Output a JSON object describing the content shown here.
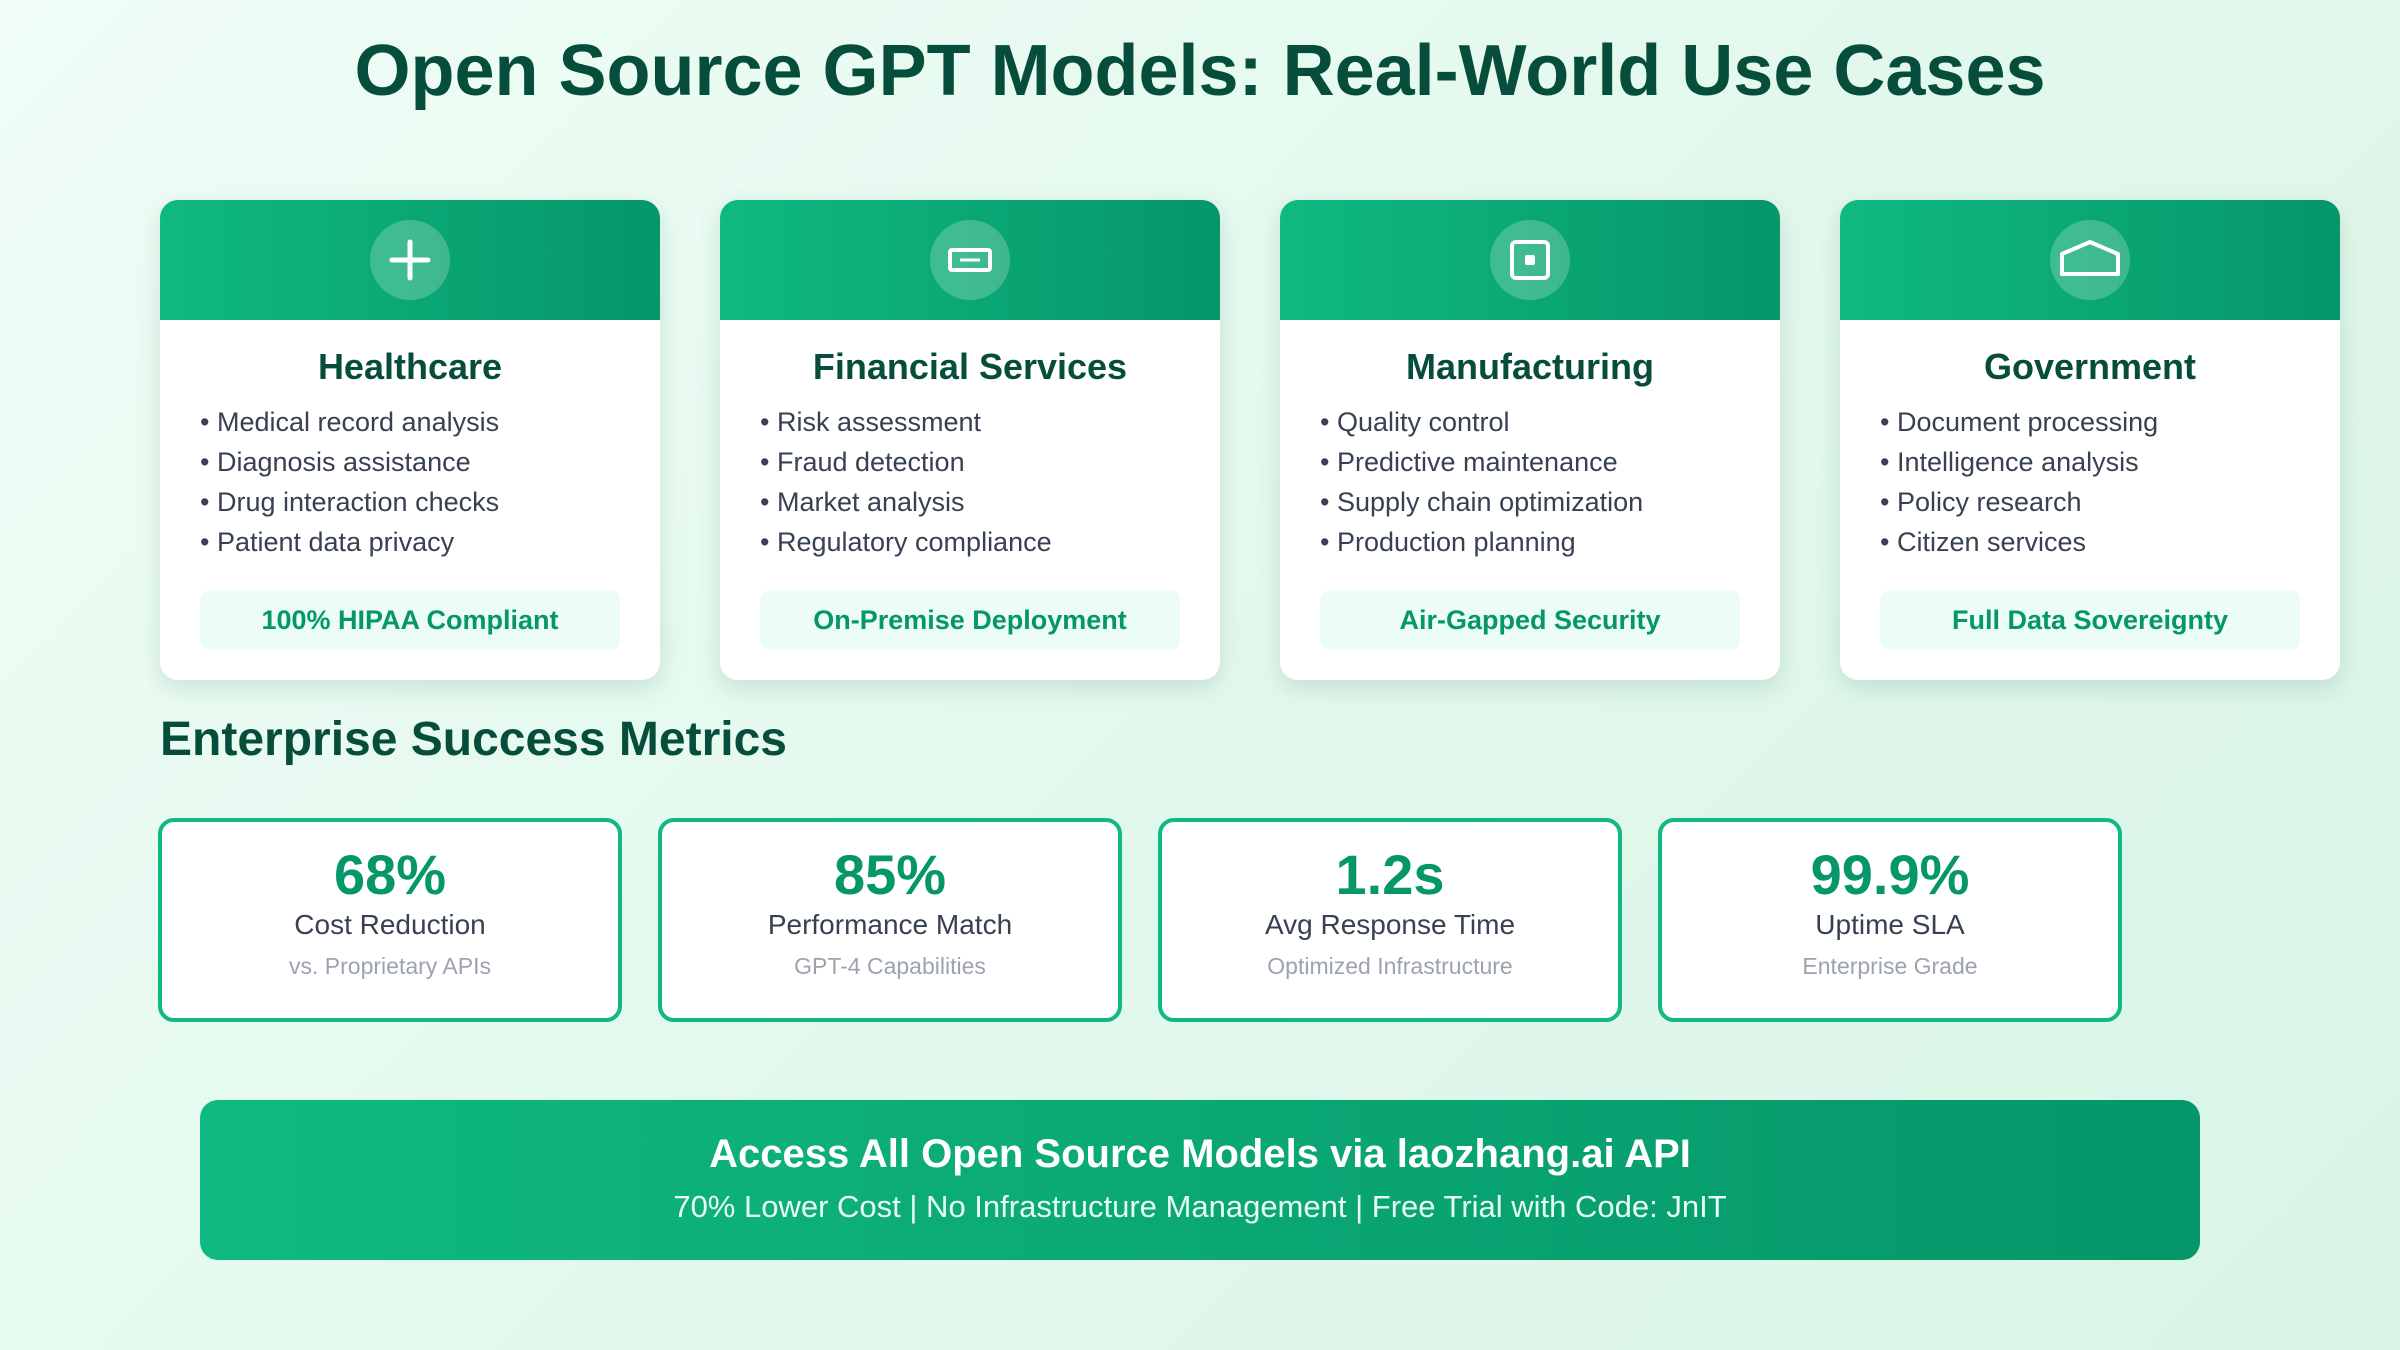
{
  "title": "Open Source GPT Models: Real-World Use Cases",
  "cards": [
    {
      "icon": "plus-icon",
      "title": "Healthcare",
      "items": [
        "Medical record analysis",
        "Diagnosis assistance",
        "Drug interaction checks",
        "Patient data privacy"
      ],
      "badge": "100% HIPAA Compliant"
    },
    {
      "icon": "card-icon",
      "title": "Financial Services",
      "items": [
        "Risk assessment",
        "Fraud detection",
        "Market analysis",
        "Regulatory compliance"
      ],
      "badge": "On-Premise Deployment"
    },
    {
      "icon": "chip-icon",
      "title": "Manufacturing",
      "items": [
        "Quality control",
        "Predictive maintenance",
        "Supply chain optimization",
        "Production planning"
      ],
      "badge": "Air-Gapped Security"
    },
    {
      "icon": "building-icon",
      "title": "Government",
      "items": [
        "Document processing",
        "Intelligence analysis",
        "Policy research",
        "Citizen services"
      ],
      "badge": "Full Data Sovereignty"
    }
  ],
  "metrics_title": "Enterprise Success Metrics",
  "metrics": [
    {
      "value": "68%",
      "label": "Cost Reduction",
      "sub": "vs. Proprietary APIs"
    },
    {
      "value": "85%",
      "label": "Performance Match",
      "sub": "GPT-4 Capabilities"
    },
    {
      "value": "1.2s",
      "label": "Avg Response Time",
      "sub": "Optimized Infrastructure"
    },
    {
      "value": "99.9%",
      "label": "Uptime SLA",
      "sub": "Enterprise Grade"
    }
  ],
  "cta": {
    "title": "Access All Open Source Models via laozhang.ai API",
    "subtitle": "70% Lower Cost | No Infrastructure Management | Free Trial with Code: JnIT"
  },
  "colors": {
    "accent": "#10b981",
    "accent_dark": "#059669",
    "heading": "#064e3b"
  }
}
